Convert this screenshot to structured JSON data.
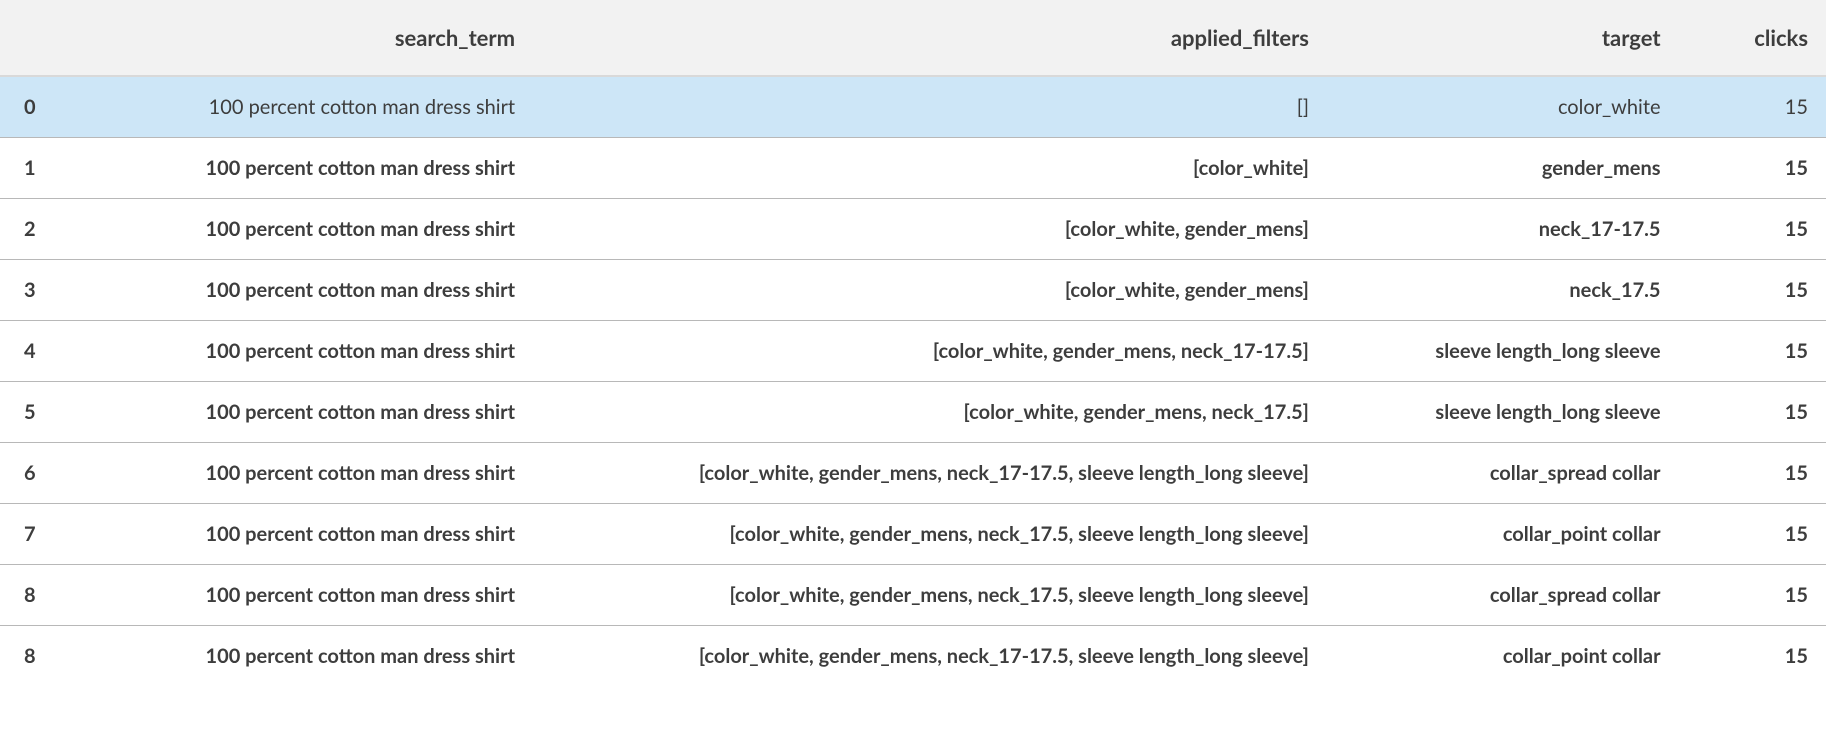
{
  "table": {
    "columns": [
      "",
      "search_term",
      "applied_filters",
      "target",
      "clicks"
    ],
    "rows": [
      {
        "idx": "0",
        "search_term": "100 percent cotton man dress shirt",
        "applied_filters": "[]",
        "target": "color_white",
        "clicks": "15",
        "highlighted": true
      },
      {
        "idx": "1",
        "search_term": "100 percent cotton man dress shirt",
        "applied_filters": "[color_white]",
        "target": "gender_mens",
        "clicks": "15",
        "highlighted": false
      },
      {
        "idx": "2",
        "search_term": "100 percent cotton man dress shirt",
        "applied_filters": "[color_white, gender_mens]",
        "target": "neck_17-17.5",
        "clicks": "15",
        "highlighted": false
      },
      {
        "idx": "3",
        "search_term": "100 percent cotton man dress shirt",
        "applied_filters": "[color_white, gender_mens]",
        "target": "neck_17.5",
        "clicks": "15",
        "highlighted": false
      },
      {
        "idx": "4",
        "search_term": "100 percent cotton man dress shirt",
        "applied_filters": "[color_white, gender_mens, neck_17-17.5]",
        "target": "sleeve length_long sleeve",
        "clicks": "15",
        "highlighted": false
      },
      {
        "idx": "5",
        "search_term": "100 percent cotton man dress shirt",
        "applied_filters": "[color_white, gender_mens, neck_17.5]",
        "target": "sleeve length_long sleeve",
        "clicks": "15",
        "highlighted": false
      },
      {
        "idx": "6",
        "search_term": "100 percent cotton man dress shirt",
        "applied_filters": "[color_white, gender_mens, neck_17-17.5, sleeve length_long sleeve]",
        "target": "collar_spread collar",
        "clicks": "15",
        "highlighted": false
      },
      {
        "idx": "7",
        "search_term": "100 percent cotton man dress shirt",
        "applied_filters": "[color_white, gender_mens, neck_17.5, sleeve length_long sleeve]",
        "target": "collar_point collar",
        "clicks": "15",
        "highlighted": false
      },
      {
        "idx": "8",
        "search_term": "100 percent cotton man dress shirt",
        "applied_filters": "[color_white, gender_mens, neck_17.5, sleeve length_long sleeve]",
        "target": "collar_spread collar",
        "clicks": "15",
        "highlighted": false
      },
      {
        "idx": "8",
        "search_term": "100 percent cotton man dress shirt",
        "applied_filters": "[color_white, gender_mens, neck_17-17.5, sleeve length_long sleeve]",
        "target": "collar_point collar",
        "clicks": "15",
        "highlighted": false
      }
    ]
  }
}
